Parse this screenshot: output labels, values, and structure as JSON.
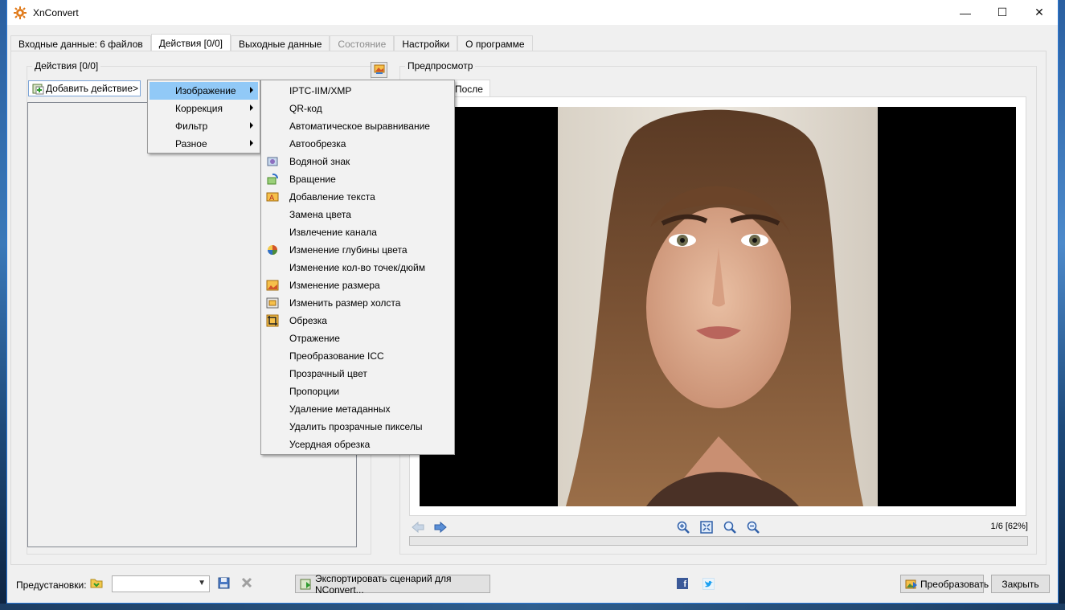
{
  "window": {
    "title": "XnConvert",
    "minimize": "—",
    "maximize": "☐",
    "close": "✕"
  },
  "tabs": [
    {
      "label": "Входные данные: 6 файлов",
      "active": false,
      "disabled": false
    },
    {
      "label": "Действия [0/0]",
      "active": true,
      "disabled": false
    },
    {
      "label": "Выходные данные",
      "active": false,
      "disabled": false
    },
    {
      "label": "Состояние",
      "active": false,
      "disabled": true
    },
    {
      "label": "Настройки",
      "active": false,
      "disabled": false
    },
    {
      "label": "О программе",
      "active": false,
      "disabled": false
    }
  ],
  "actions_group": {
    "title": "Действия [0/0]",
    "add_button": "Добавить действие>"
  },
  "preview_group": {
    "title": "Предпросмотр",
    "tab_label": "После",
    "page_info": "1/6 [62%]",
    "progress": 0
  },
  "menu_main": [
    {
      "label": "Изображение",
      "highlighted": true
    },
    {
      "label": "Коррекция",
      "highlighted": false
    },
    {
      "label": "Фильтр",
      "highlighted": false
    },
    {
      "label": "Разное",
      "highlighted": false
    }
  ],
  "menu_sub": [
    {
      "label": "IPTC-IIM/XMP",
      "icon": ""
    },
    {
      "label": "QR-код",
      "icon": ""
    },
    {
      "label": "Автоматическое выравнивание",
      "icon": ""
    },
    {
      "label": "Автообрезка",
      "icon": ""
    },
    {
      "label": "Водяной знак",
      "icon": "watermark-icon"
    },
    {
      "label": "Вращение",
      "icon": "rotate-icon"
    },
    {
      "label": "Добавление текста",
      "icon": "add-text-icon"
    },
    {
      "label": "Замена цвета",
      "icon": ""
    },
    {
      "label": "Извлечение канала",
      "icon": ""
    },
    {
      "label": "Изменение глубины цвета",
      "icon": "color-depth-icon"
    },
    {
      "label": "Изменение кол-во точек/дюйм",
      "icon": ""
    },
    {
      "label": "Изменение размера",
      "icon": "resize-icon"
    },
    {
      "label": "Изменить размер холста",
      "icon": "canvas-size-icon"
    },
    {
      "label": "Обрезка",
      "icon": "crop-icon"
    },
    {
      "label": "Отражение",
      "icon": ""
    },
    {
      "label": "Преобразование ICC",
      "icon": ""
    },
    {
      "label": "Прозрачный цвет",
      "icon": ""
    },
    {
      "label": "Пропорции",
      "icon": ""
    },
    {
      "label": "Удаление метаданных",
      "icon": ""
    },
    {
      "label": "Удалить прозрачные пикселы",
      "icon": ""
    },
    {
      "label": "Усердная обрезка",
      "icon": ""
    }
  ],
  "bottom": {
    "presets_label": "Предустановки:",
    "preset_value": "",
    "export_button": "Экспортировать сценарий для NConvert...",
    "convert_button": "Преобразовать",
    "close_button": "Закрыть",
    "facebook": "f"
  },
  "colors": {
    "accent": "#2b79d6",
    "menu_highlight": "#91c9f7",
    "progress": "#06b025"
  }
}
